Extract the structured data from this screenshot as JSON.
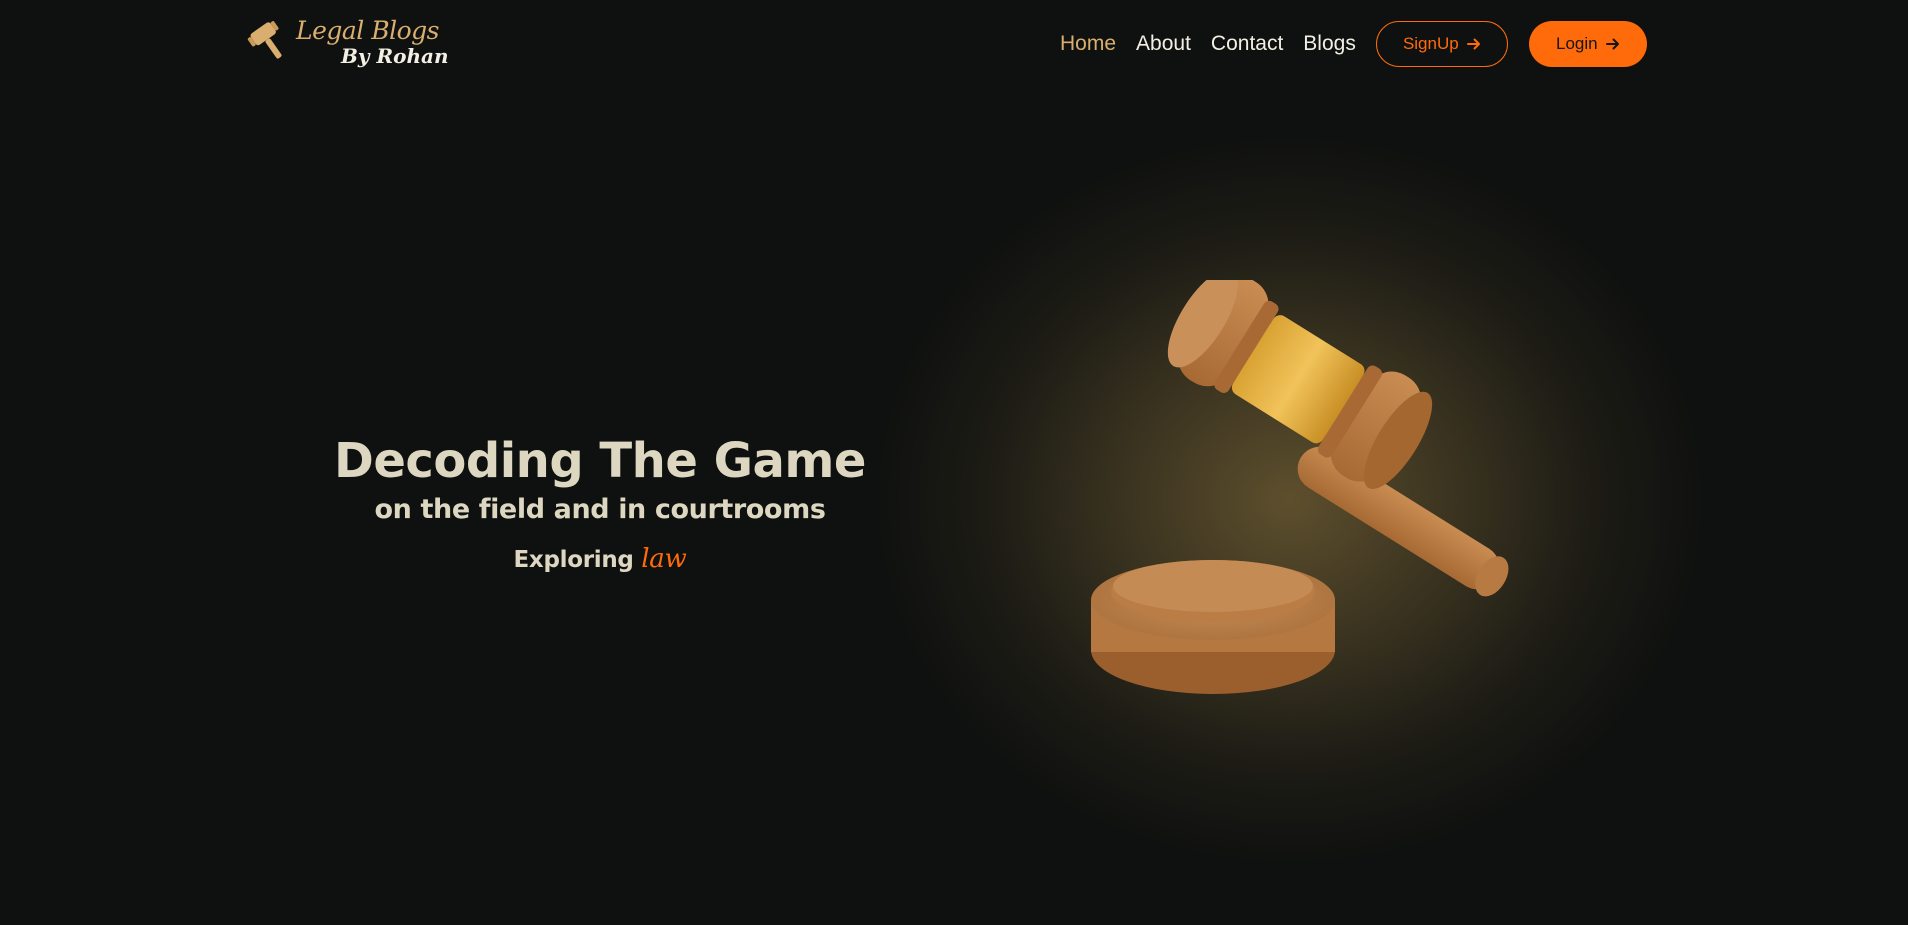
{
  "header": {
    "logo": {
      "title": "Legal Blogs",
      "subtitle": "By Rohan",
      "icon": "gavel-icon"
    },
    "nav": [
      {
        "label": "Home",
        "active": true
      },
      {
        "label": "About",
        "active": false
      },
      {
        "label": "Contact",
        "active": false
      },
      {
        "label": "Blogs",
        "active": false
      }
    ],
    "signup_label": "SignUp",
    "login_label": "Login"
  },
  "hero": {
    "title": "Decoding The Game",
    "subtitle": "on the field and in courtrooms",
    "tagline_prefix": "Exploring",
    "tagline_accent": "law",
    "illustration": "gavel-illustration"
  },
  "colors": {
    "background": "#0f1110",
    "accent": "#ff6b0a",
    "gold": "#d9ae6f",
    "text": "#ddd7c1"
  }
}
